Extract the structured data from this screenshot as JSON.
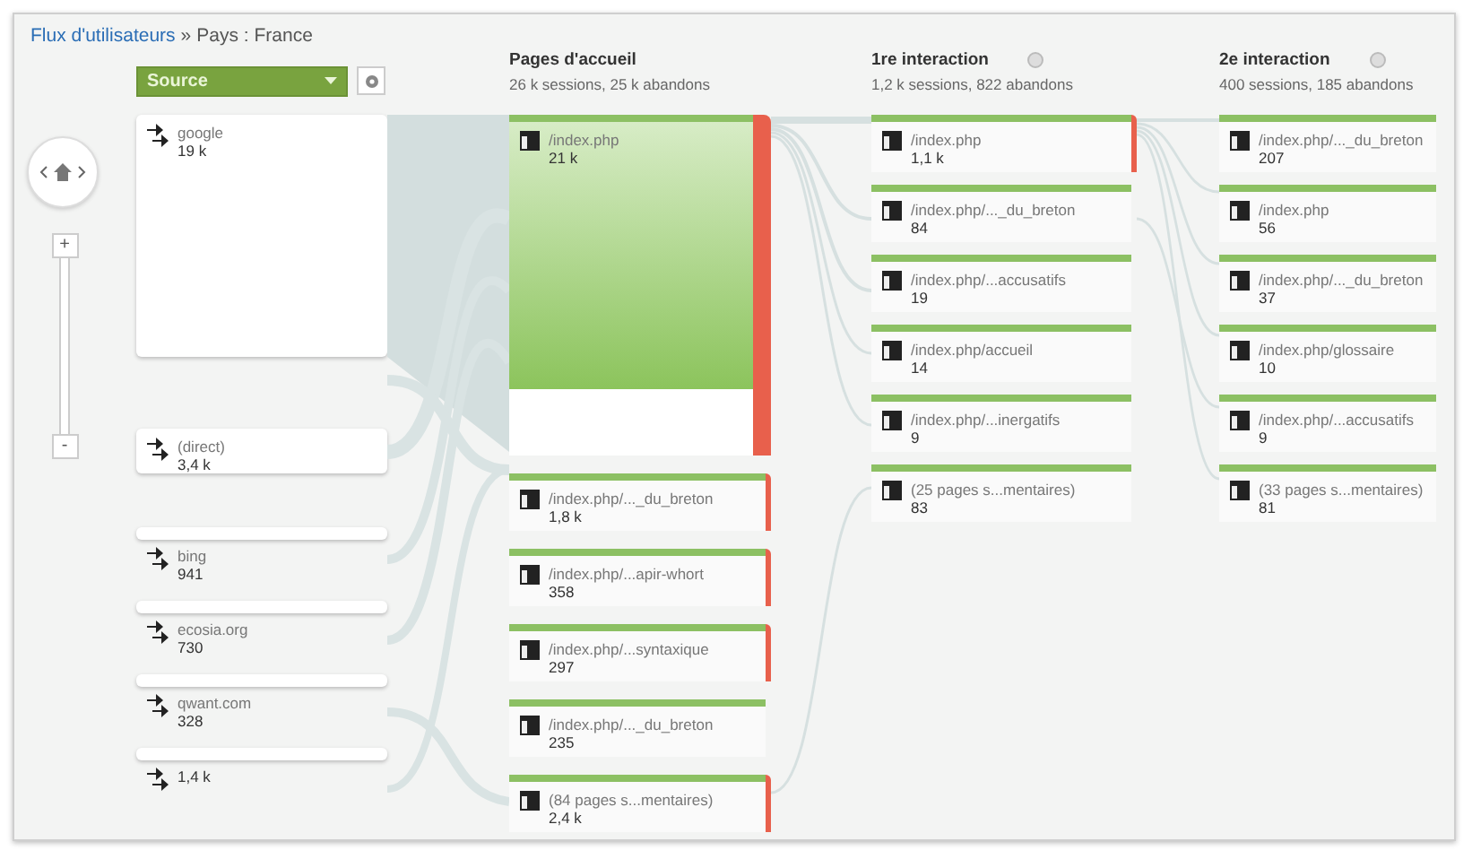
{
  "breadcrumb": {
    "link": "Flux d'utilisateurs",
    "separator": "»",
    "current": "Pays : France"
  },
  "dimension_dropdown": {
    "value": "Source"
  },
  "zoom": {
    "plus": "+",
    "minus": "-"
  },
  "source_nodes": [
    {
      "kind": "large",
      "label": "google",
      "value": "19 k"
    },
    {
      "kind": "box",
      "label": "(direct)",
      "value": "3,4 k"
    },
    {
      "kind": "strip",
      "label": "bing",
      "value": "941"
    },
    {
      "kind": "strip",
      "label": "ecosia.org",
      "value": "730"
    },
    {
      "kind": "strip",
      "label": "qwant.com",
      "value": "328"
    },
    {
      "kind": "strip",
      "value": "1,4 k"
    }
  ],
  "columns": [
    {
      "title": "Pages d'accueil",
      "summary": "26 k sessions, 25 k abandons",
      "info": false,
      "nodes": [
        {
          "kind": "large",
          "label": "/index.php",
          "value": "21 k",
          "exit_bar": true
        },
        {
          "kind": "node",
          "label": "/index.php/..._du_breton",
          "value": "1,8 k",
          "exit_bar": true
        },
        {
          "kind": "node",
          "label": "/index.php/...apir-whort",
          "value": "358",
          "exit_bar": true
        },
        {
          "kind": "node",
          "label": "/index.php/...syntaxique",
          "value": "297",
          "exit_bar": true
        },
        {
          "kind": "node",
          "label": "/index.php/..._du_breton",
          "value": "235",
          "exit_bar": false
        },
        {
          "kind": "node",
          "label": "(84 pages s...mentaires)",
          "value": "2,4 k",
          "exit_bar": true
        }
      ]
    },
    {
      "title": "1re interaction",
      "summary": "1,2 k sessions, 822 abandons",
      "info": true,
      "nodes": [
        {
          "kind": "node",
          "label": "/index.php",
          "value": "1,1 k",
          "exit_bar": true
        },
        {
          "kind": "node",
          "label": "/index.php/..._du_breton",
          "value": "84",
          "exit_bar": false
        },
        {
          "kind": "node",
          "label": "/index.php/...accusatifs",
          "value": "19",
          "exit_bar": false
        },
        {
          "kind": "node",
          "label": "/index.php/accueil",
          "value": "14",
          "exit_bar": false
        },
        {
          "kind": "node",
          "label": "/index.php/...inergatifs",
          "value": "9",
          "exit_bar": false
        },
        {
          "kind": "node",
          "label": "(25 pages s...mentaires)",
          "value": "83",
          "exit_bar": false
        }
      ]
    },
    {
      "title": "2e interaction",
      "summary": "400 sessions, 185 abandons",
      "info": true,
      "nodes": [
        {
          "kind": "node",
          "label": "/index.php/..._du_breton",
          "value": "207",
          "exit_bar": false
        },
        {
          "kind": "node",
          "label": "/index.php",
          "value": "56",
          "exit_bar": false
        },
        {
          "kind": "node",
          "label": "/index.php/..._du_breton",
          "value": "37",
          "exit_bar": false
        },
        {
          "kind": "node",
          "label": "/index.php/glossaire",
          "value": "10",
          "exit_bar": false
        },
        {
          "kind": "node",
          "label": "/index.php/...accusatifs",
          "value": "9",
          "exit_bar": false
        },
        {
          "kind": "node",
          "label": "(33 pages s...mentaires)",
          "value": "81",
          "exit_bar": false
        }
      ]
    }
  ]
}
